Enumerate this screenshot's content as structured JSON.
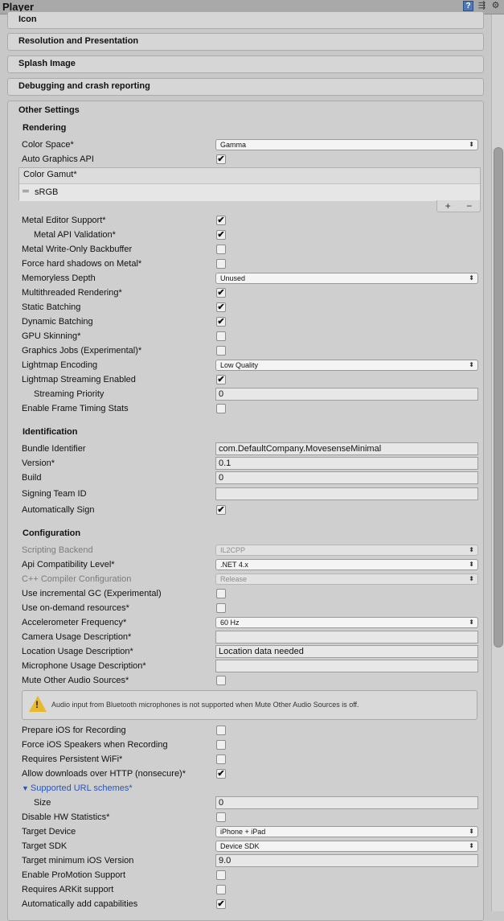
{
  "window": {
    "title": "Player"
  },
  "sections": {
    "icon": "Icon",
    "resolution": "Resolution and Presentation",
    "splash": "Splash Image",
    "debugging": "Debugging and crash reporting",
    "other": "Other Settings"
  },
  "rendering": {
    "heading": "Rendering",
    "color_space": {
      "label": "Color Space*",
      "value": "Gamma"
    },
    "auto_graphics_api": {
      "label": "Auto Graphics API",
      "checked": true
    },
    "color_gamut": {
      "label": "Color Gamut*",
      "items": [
        "sRGB"
      ],
      "add": "+",
      "remove": "−"
    },
    "metal_editor_support": {
      "label": "Metal Editor Support*",
      "checked": true
    },
    "metal_api_validation": {
      "label": "Metal API Validation*",
      "checked": true
    },
    "metal_write_only": {
      "label": "Metal Write-Only Backbuffer",
      "checked": false
    },
    "force_hard_shadows": {
      "label": "Force hard shadows on Metal*",
      "checked": false
    },
    "memoryless_depth": {
      "label": "Memoryless Depth",
      "value": "Unused"
    },
    "multithreaded": {
      "label": "Multithreaded Rendering*",
      "checked": true
    },
    "static_batching": {
      "label": "Static Batching",
      "checked": true
    },
    "dynamic_batching": {
      "label": "Dynamic Batching",
      "checked": true
    },
    "gpu_skinning": {
      "label": "GPU Skinning*",
      "checked": false
    },
    "graphics_jobs": {
      "label": "Graphics Jobs (Experimental)*",
      "checked": false
    },
    "lightmap_encoding": {
      "label": "Lightmap Encoding",
      "value": "Low Quality"
    },
    "lightmap_streaming": {
      "label": "Lightmap Streaming Enabled",
      "checked": true
    },
    "streaming_priority": {
      "label": "Streaming Priority",
      "value": "0"
    },
    "frame_timing": {
      "label": "Enable Frame Timing Stats",
      "checked": false
    }
  },
  "identification": {
    "heading": "Identification",
    "bundle_identifier": {
      "label": "Bundle Identifier",
      "value": "com.DefaultCompany.MovesenseMinimal"
    },
    "version": {
      "label": "Version*",
      "value": "0.1"
    },
    "build": {
      "label": "Build",
      "value": "0"
    },
    "signing_team": {
      "label": "Signing Team ID",
      "value": ""
    },
    "auto_sign": {
      "label": "Automatically Sign",
      "checked": true
    }
  },
  "configuration": {
    "heading": "Configuration",
    "scripting_backend": {
      "label": "Scripting Backend",
      "value": "IL2CPP"
    },
    "api_compat": {
      "label": "Api Compatibility Level*",
      "value": ".NET 4.x"
    },
    "cpp_compiler": {
      "label": "C++ Compiler Configuration",
      "value": "Release"
    },
    "incremental_gc": {
      "label": "Use incremental GC (Experimental)",
      "checked": false
    },
    "on_demand": {
      "label": "Use on-demand resources*",
      "checked": false
    },
    "accel_freq": {
      "label": "Accelerometer Frequency*",
      "value": "60 Hz"
    },
    "camera_usage": {
      "label": "Camera Usage Description*",
      "value": ""
    },
    "location_usage": {
      "label": "Location Usage Description*",
      "value": "Location data needed"
    },
    "mic_usage": {
      "label": "Microphone Usage Description*",
      "value": ""
    },
    "mute_audio": {
      "label": "Mute Other Audio Sources*",
      "checked": false
    },
    "warning": "Audio input from Bluetooth microphones is not supported when Mute Other Audio Sources is off.",
    "prepare_ios": {
      "label": "Prepare iOS for Recording",
      "checked": false
    },
    "force_speakers": {
      "label": "Force iOS Speakers when Recording",
      "checked": false
    },
    "persistent_wifi": {
      "label": "Requires Persistent WiFi*",
      "checked": false
    },
    "allow_http": {
      "label": "Allow downloads over HTTP (nonsecure)*",
      "checked": true
    },
    "url_schemes": {
      "label": "Supported URL schemes*",
      "size_label": "Size",
      "size": "0"
    },
    "disable_hw_stats": {
      "label": "Disable HW Statistics*",
      "checked": false
    },
    "target_device": {
      "label": "Target Device",
      "value": "iPhone + iPad"
    },
    "target_sdk": {
      "label": "Target SDK",
      "value": "Device SDK"
    },
    "min_ios": {
      "label": "Target minimum iOS Version",
      "value": "9.0"
    },
    "promotion": {
      "label": "Enable ProMotion Support",
      "checked": false
    },
    "arkit": {
      "label": "Requires ARKit support",
      "checked": false
    },
    "auto_caps": {
      "label": "Automatically add capabilities",
      "checked": true
    }
  },
  "icons": {
    "checkmark": "✔",
    "dropdown_arrow": "⬍",
    "warning": "!"
  }
}
